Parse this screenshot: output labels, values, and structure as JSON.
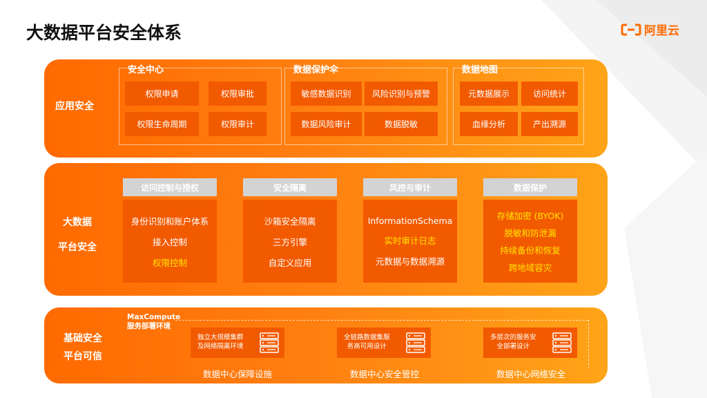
{
  "page": {
    "title": "大数据平台安全体系",
    "logo_text": "阿里云",
    "accent_color": "#ff6a00"
  },
  "app_security": {
    "label": "应用安全",
    "groups": [
      {
        "title": "安全中心",
        "items": [
          "权限申请",
          "权限审批",
          "权限生命周期",
          "权限审计"
        ]
      },
      {
        "title": "数据保护伞",
        "items": [
          "敏感数据识别",
          "风险识别与预警",
          "数据风险审计",
          "数据脱敏"
        ]
      },
      {
        "title": "数据地图",
        "items": [
          "元数据展示",
          "访问统计",
          "血缘分析",
          "产出溯源"
        ]
      }
    ]
  },
  "bigdata_security": {
    "label_line1": "大数据",
    "label_line2": "平台安全",
    "columns": [
      {
        "head": "访问控制与授权",
        "items": [
          {
            "text": "身份识别和账户体系",
            "highlight": false
          },
          {
            "text": "接入控制",
            "highlight": false
          },
          {
            "text": "权限控制",
            "highlight": true
          }
        ]
      },
      {
        "head": "安全隔离",
        "items": [
          {
            "text": "沙箱安全隔离",
            "highlight": false
          },
          {
            "text": "三方引擎",
            "highlight": false
          },
          {
            "text": "自定义应用",
            "highlight": false
          }
        ]
      },
      {
        "head": "风控与审计",
        "items": [
          {
            "text": "InformationSchema",
            "highlight": false
          },
          {
            "text": "实时审计日志",
            "highlight": true
          },
          {
            "text": "元数据与数据溯源",
            "highlight": false
          }
        ]
      },
      {
        "head": "数据保护",
        "items": [
          {
            "text": "存储加密 (BYOK)",
            "highlight": true
          },
          {
            "text": "脱敏和防泄漏",
            "highlight": true
          },
          {
            "text": "持续备份和恢复",
            "highlight": true
          },
          {
            "text": "跨地域容灾",
            "highlight": true
          }
        ]
      }
    ]
  },
  "base_security": {
    "label_line1": "基础安全",
    "label_line2": "平台可信",
    "env_title_line1": "MaxCompute",
    "env_title_line2": "服务部署环境",
    "boxes": [
      {
        "line1": "独立大规模集群",
        "line2": "及网络隔离环境",
        "caption": "数据中心保障设施",
        "icon": "server-icon"
      },
      {
        "line1": "全链路数据集服",
        "line2": "务高可用设计",
        "caption": "数据中心安全管控",
        "icon": "server-icon"
      },
      {
        "line1": "多层次的服务安",
        "line2": "全部署设计",
        "caption": "数据中心网络安全",
        "icon": "server-icon"
      }
    ]
  }
}
